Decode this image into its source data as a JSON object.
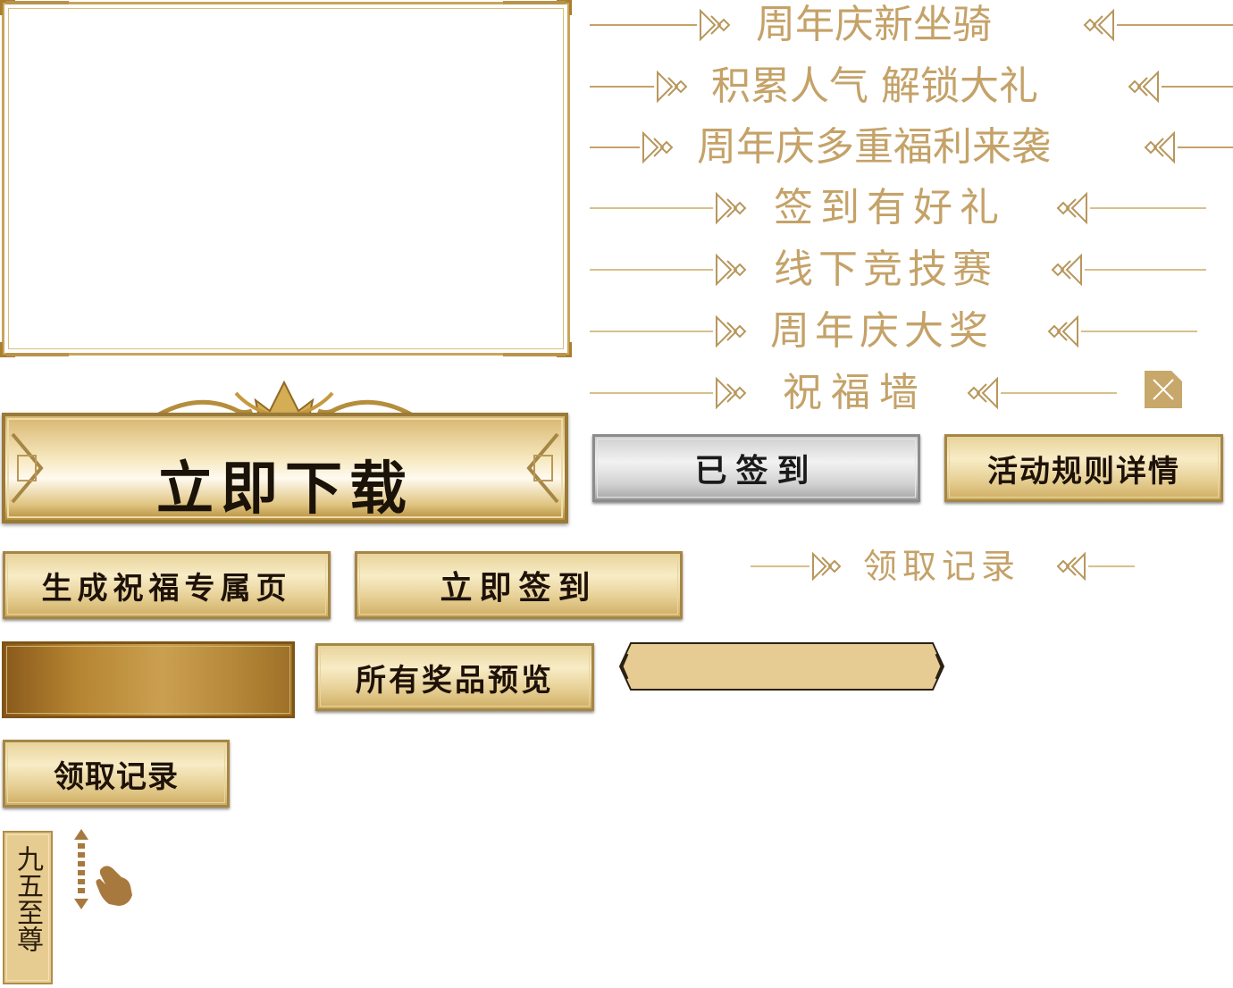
{
  "title_rows": [
    {
      "text": "周年庆新坐骑"
    },
    {
      "text": "积累人气 解锁大礼"
    },
    {
      "text": "周年庆多重福利来袭"
    },
    {
      "text": "签到有好礼"
    },
    {
      "text": "线下竞技赛"
    },
    {
      "text": "周年庆大奖"
    },
    {
      "text": "祝福墙"
    },
    {
      "text": "领取记录"
    }
  ],
  "buttons": {
    "download": "立即下载",
    "signed_in": "已签到",
    "activity_rules": "活动规则详情",
    "generate_blessing": "生成祝福专属页",
    "sign_in_now": "立即签到",
    "all_prizes": "所有奖品预览",
    "claim_records": "领取记录"
  },
  "vertical_label": "九五至尊",
  "icons": [
    "close-icon",
    "swipe-hand-icon",
    "scroll-arrows-icon",
    "crown-ornament-icon",
    "diamond-arrow-icon"
  ],
  "colors": {
    "gold": "#c4a268",
    "dark_gold": "#a8802f",
    "text_dark": "#1e1208"
  }
}
